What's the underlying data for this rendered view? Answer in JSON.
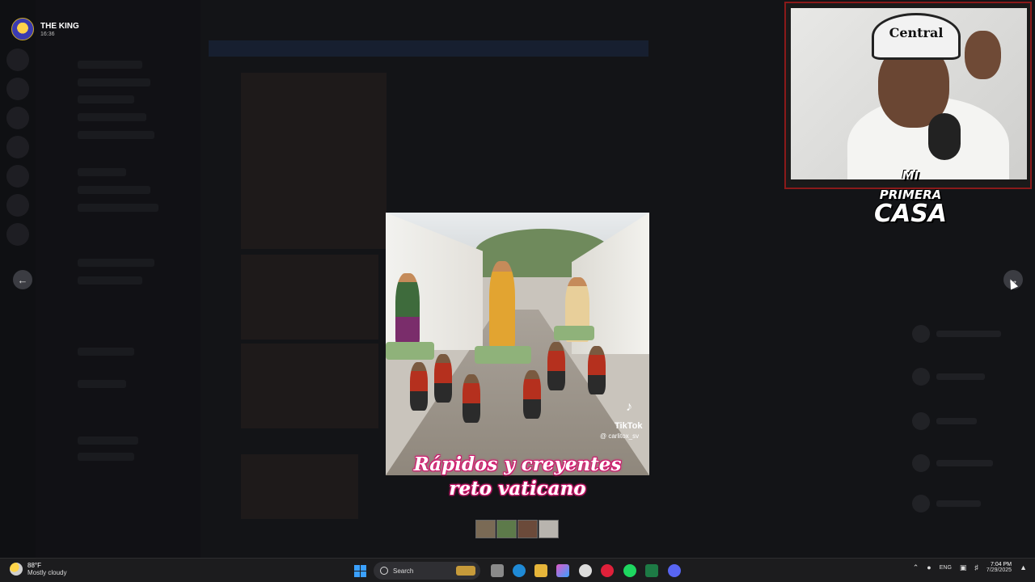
{
  "user": {
    "name": "THE KING",
    "time": "16:36"
  },
  "media": {
    "watermark_brand": "TikTok",
    "watermark_handle": "@ carlitox_sv",
    "caption_line1": "Rápidos y creyentes",
    "caption_line2": "reto vaticano",
    "thumbnail_count": 4
  },
  "navigation": {
    "prev_icon": "arrow-left-icon",
    "next_icon": "arrow-right-icon"
  },
  "webcam": {
    "cap_text": "Central",
    "logo_line1": "MI PRIMERA",
    "logo_line2": "CASA"
  },
  "taskbar": {
    "weather_temp": "88°F",
    "weather_desc": "Mostly cloudy",
    "search_placeholder": "Search",
    "language": "ENG",
    "time": "7:04 PM",
    "date": "7/29/2025",
    "apps": [
      "file-explorer-icon",
      "edge-icon",
      "folder-icon",
      "copilot-icon",
      "chrome-icon",
      "opera-icon",
      "spotify-icon",
      "excel-icon",
      "discord-icon"
    ]
  },
  "colors": {
    "caption_outline": "#e0207a",
    "accent_blue": "#3aa0ff",
    "cam_border": "#8a1a1a"
  }
}
